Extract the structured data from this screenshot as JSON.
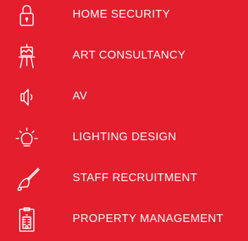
{
  "colors": {
    "background": "#e31e2d",
    "foreground": "#ffffff"
  },
  "services": [
    {
      "label": "HOME SECURITY",
      "icon": "padlock-icon"
    },
    {
      "label": "ART CONSULTANCY",
      "icon": "easel-icon"
    },
    {
      "label": "AV",
      "icon": "speaker-icon"
    },
    {
      "label": "LIGHTING DESIGN",
      "icon": "light-bulb-icon"
    },
    {
      "label": "STAFF RECRUITMENT",
      "icon": "hand-bell-icon"
    },
    {
      "label": "PROPERTY MANAGEMENT",
      "icon": "clipboard-building-icon"
    }
  ]
}
